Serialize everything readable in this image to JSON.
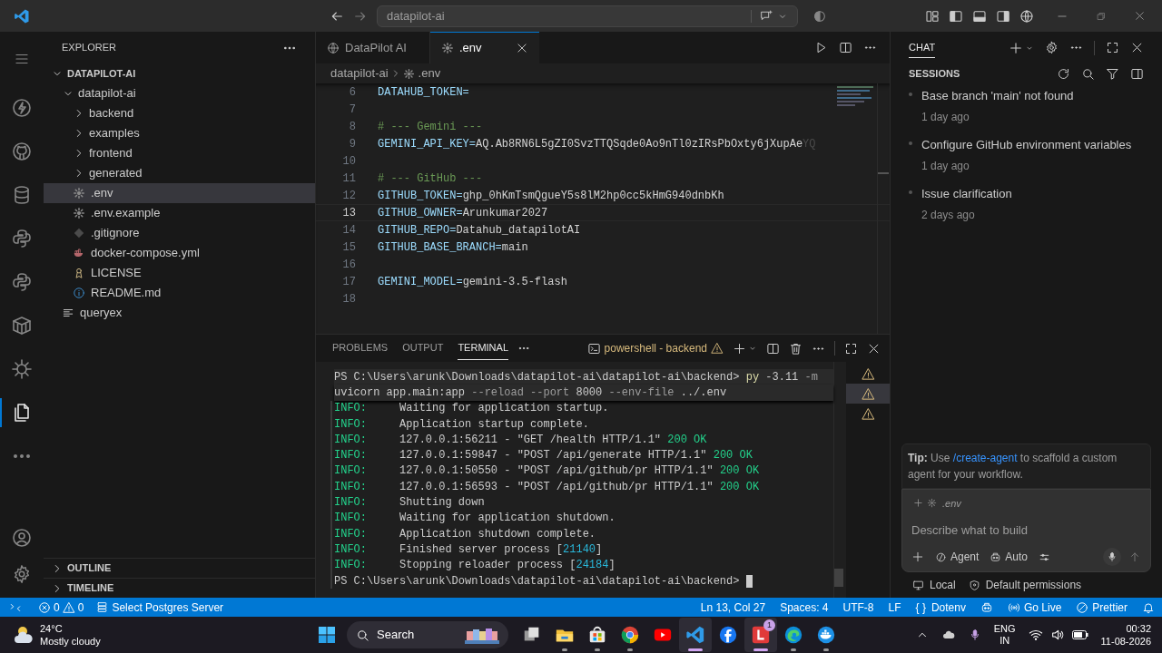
{
  "title_bar": {
    "search": "datapilot-ai"
  },
  "activity_bar": {
    "items": [
      {
        "kind": "menu",
        "selected": false
      },
      {
        "kind": "lightning",
        "selected": false
      },
      {
        "kind": "github",
        "selected": false
      },
      {
        "kind": "database",
        "selected": false
      },
      {
        "kind": "python",
        "selected": false
      },
      {
        "kind": "python",
        "selected": false
      },
      {
        "kind": "cube",
        "selected": false
      },
      {
        "kind": "helm",
        "selected": false
      },
      {
        "kind": "files",
        "selected": true
      },
      {
        "kind": "more",
        "selected": false
      }
    ],
    "bottom": [
      {
        "kind": "account"
      },
      {
        "kind": "settings"
      }
    ]
  },
  "explorer": {
    "title": "EXPLORER",
    "tree": [
      {
        "label": "DATAPILOT-AI",
        "kind": "root",
        "expanded": true,
        "selected": false,
        "children": [
          {
            "label": "datapilot-ai",
            "kind": "folder",
            "expanded": true,
            "selected": false,
            "children": [
              {
                "label": "backend",
                "kind": "folder",
                "expanded": false,
                "selected": false
              },
              {
                "label": "examples",
                "kind": "folder",
                "expanded": false,
                "selected": false
              },
              {
                "label": "frontend",
                "kind": "folder",
                "expanded": false,
                "selected": false
              },
              {
                "label": "generated",
                "kind": "folder",
                "expanded": false,
                "selected": false
              },
              {
                "label": ".env",
                "kind": "settings-file",
                "selected": true
              },
              {
                "label": ".env.example",
                "kind": "settings-file",
                "selected": false
              },
              {
                "label": ".gitignore",
                "kind": "ignore-file",
                "selected": false
              },
              {
                "label": "docker-compose.yml",
                "kind": "docker-file",
                "selected": false
              },
              {
                "label": "LICENSE",
                "kind": "license-file",
                "selected": false
              },
              {
                "label": "README.md",
                "kind": "info-file",
                "selected": false
              }
            ]
          },
          {
            "label": "queryex",
            "kind": "text-file",
            "selected": false
          }
        ]
      }
    ],
    "sections": [
      {
        "label": "OUTLINE",
        "expanded": false
      },
      {
        "label": "TIMELINE",
        "expanded": false
      }
    ]
  },
  "editor": {
    "tabs": [
      {
        "label": "DataPilot AI",
        "kind": "web",
        "selected": false
      },
      {
        "label": ".env",
        "kind": "settings-file",
        "selected": true
      }
    ],
    "breadcrumb": [
      "datapilot-ai",
      ".env"
    ],
    "lines": [
      {
        "number": "6",
        "kind": "pair",
        "key": "DATAHUB_TOKEN=",
        "current": false
      },
      {
        "number": "7",
        "kind": "blank",
        "current": false
      },
      {
        "number": "8",
        "kind": "comment",
        "text": "# --- Gemini ---",
        "current": false
      },
      {
        "number": "9",
        "kind": "pair",
        "key": "GEMINI_API_KEY=",
        "value": "AQ.Ab8RN6L5gZI0SvzTTQSqde0Ao9nTl0zIRsPbOxty6jXupAe",
        "ghost": "YQ",
        "current": false
      },
      {
        "number": "10",
        "kind": "blank",
        "current": false
      },
      {
        "number": "11",
        "kind": "comment",
        "text": "# --- GitHub ---",
        "current": false
      },
      {
        "number": "12",
        "kind": "pair",
        "key": "GITHUB_TOKEN=",
        "value": "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",
        "current": false
      },
      {
        "number": "13",
        "kind": "pair",
        "key": "GITHUB_OWNER=",
        "value": "Arunkumar2027",
        "current": true
      },
      {
        "number": "14",
        "kind": "pair",
        "key": "GITHUB_REPO=",
        "value": "Datahub_datapilotAI",
        "current": false
      },
      {
        "number": "15",
        "kind": "pair",
        "key": "GITHUB_BASE_BRANCH=",
        "value": "main",
        "current": false
      },
      {
        "number": "16",
        "kind": "blank",
        "current": false
      },
      {
        "number": "17",
        "kind": "pair",
        "key": "GEMINI_MODEL=",
        "value": "gemini-3.5-flash",
        "current": false
      },
      {
        "number": "18",
        "kind": "blank",
        "current": false
      }
    ]
  },
  "panel": {
    "tabs": [
      {
        "label": "PROBLEMS",
        "selected": false
      },
      {
        "label": "OUTPUT",
        "selected": false
      },
      {
        "label": "TERMINAL",
        "selected": true
      }
    ],
    "terminal_name": "powershell - backend",
    "terminal_instances": [
      {
        "selected": false
      },
      {
        "selected": true
      },
      {
        "selected": false
      }
    ],
    "lines": [
      {
        "sticky": true,
        "segments": [
          {
            "text": "PS C:\\Users\\arunk\\Downloads\\datapilot-ai\\datapilot-ai\\backend> ",
            "kind": "plain"
          },
          {
            "text": "py",
            "kind": "command"
          },
          {
            "text": " -3.11 ",
            "kind": "plain"
          },
          {
            "text": "-m",
            "kind": "flag"
          }
        ]
      },
      {
        "sticky": true,
        "segments": [
          {
            "text": "uvicorn app.main:app ",
            "kind": "plain"
          },
          {
            "text": "--reload --port ",
            "kind": "flag"
          },
          {
            "text": "8000 ",
            "kind": "plain"
          },
          {
            "text": "--env-file ",
            "kind": "flag"
          },
          {
            "text": "../.env",
            "kind": "plain"
          }
        ]
      },
      {
        "sticky": false,
        "segments": [
          {
            "text": "INFO:",
            "kind": "level"
          },
          {
            "text": "     Waiting for application startup.",
            "kind": "plain"
          }
        ]
      },
      {
        "sticky": false,
        "segments": [
          {
            "text": "INFO:",
            "kind": "level"
          },
          {
            "text": "     Application startup complete.",
            "kind": "plain"
          }
        ]
      },
      {
        "sticky": false,
        "segments": [
          {
            "text": "INFO:",
            "kind": "level"
          },
          {
            "text": "     127.0.0.1:56211 - \"GET /health HTTP/1.1\" ",
            "kind": "plain"
          },
          {
            "text": "200 OK",
            "kind": "status"
          }
        ]
      },
      {
        "sticky": false,
        "segments": [
          {
            "text": "INFO:",
            "kind": "level"
          },
          {
            "text": "     127.0.0.1:59847 - \"POST /api/generate HTTP/1.1\" ",
            "kind": "plain"
          },
          {
            "text": "200 OK",
            "kind": "status"
          }
        ]
      },
      {
        "sticky": false,
        "segments": [
          {
            "text": "INFO:",
            "kind": "level"
          },
          {
            "text": "     127.0.0.1:50550 - \"POST /api/github/pr HTTP/1.1\" ",
            "kind": "plain"
          },
          {
            "text": "200 OK",
            "kind": "status"
          }
        ]
      },
      {
        "sticky": false,
        "segments": [
          {
            "text": "INFO:",
            "kind": "level"
          },
          {
            "text": "     127.0.0.1:56593 - \"POST /api/github/pr HTTP/1.1\" ",
            "kind": "plain"
          },
          {
            "text": "200 OK",
            "kind": "status"
          }
        ]
      },
      {
        "sticky": false,
        "segments": [
          {
            "text": "INFO:",
            "kind": "level"
          },
          {
            "text": "     Shutting down",
            "kind": "plain"
          }
        ]
      },
      {
        "sticky": false,
        "segments": [
          {
            "text": "INFO:",
            "kind": "level"
          },
          {
            "text": "     Waiting for application shutdown.",
            "kind": "plain"
          }
        ]
      },
      {
        "sticky": false,
        "segments": [
          {
            "text": "INFO:",
            "kind": "level"
          },
          {
            "text": "     Application shutdown complete.",
            "kind": "plain"
          }
        ]
      },
      {
        "sticky": false,
        "segments": [
          {
            "text": "INFO:",
            "kind": "level"
          },
          {
            "text": "     Finished server process [",
            "kind": "plain"
          },
          {
            "text": "21140",
            "kind": "number"
          },
          {
            "text": "]",
            "kind": "plain"
          }
        ]
      },
      {
        "sticky": false,
        "segments": [
          {
            "text": "INFO:",
            "kind": "level"
          },
          {
            "text": "     Stopping reloader process [",
            "kind": "plain"
          },
          {
            "text": "24184",
            "kind": "number"
          },
          {
            "text": "]",
            "kind": "plain"
          }
        ]
      },
      {
        "sticky": false,
        "cursor": true,
        "segments": [
          {
            "text": "PS C:\\Users\\arunk\\Downloads\\datapilot-ai\\datapilot-ai\\backend> ",
            "kind": "plain"
          }
        ]
      }
    ]
  },
  "chat": {
    "title": "CHAT",
    "sessions_title": "SESSIONS",
    "sessions": [
      {
        "title": "Base branch 'main' not found",
        "time": "1 day ago"
      },
      {
        "title": "Configure GitHub environment variables",
        "time": "1 day ago"
      },
      {
        "title": "Issue clarification",
        "time": "2 days ago"
      }
    ],
    "tip": {
      "label": "Tip:",
      "before": " Use ",
      "link": "/create-agent",
      "after": " to scaffold a custom agent for your workflow."
    },
    "input": {
      "context": ".env",
      "placeholder": "Describe what to build",
      "mode": "Agent",
      "model": "Auto"
    },
    "footer": [
      {
        "kind": "local",
        "label": "Local"
      },
      {
        "kind": "permissions",
        "label": "Default permissions"
      }
    ]
  },
  "status_bar": {
    "left": [
      {
        "kind": "remote"
      },
      {
        "kind": "problems",
        "errors": "0",
        "warnings": "0"
      },
      {
        "kind": "postgres",
        "label": "Select Postgres Server"
      }
    ],
    "right": [
      {
        "kind": "text",
        "label": "Ln 13, Col 27"
      },
      {
        "kind": "text",
        "label": "Spaces: 4"
      },
      {
        "kind": "text",
        "label": "UTF-8"
      },
      {
        "kind": "text",
        "label": "LF"
      },
      {
        "kind": "language",
        "glyph": "{ }",
        "label": "Dotenv"
      },
      {
        "kind": "copilot"
      },
      {
        "kind": "live",
        "label": "Go Live"
      },
      {
        "kind": "prettier",
        "label": "Prettier"
      },
      {
        "kind": "bell"
      }
    ]
  },
  "taskbar": {
    "weather": {
      "temp": "24°C",
      "desc": "Mostly cloudy"
    },
    "search": "Search",
    "apps": [
      {
        "kind": "task-view",
        "running": false,
        "selected": false
      },
      {
        "kind": "folder",
        "running": true,
        "selected": false
      },
      {
        "kind": "store",
        "running": true,
        "selected": false
      },
      {
        "kind": "chrome",
        "running": true,
        "selected": false
      },
      {
        "kind": "youtube",
        "running": false,
        "selected": false
      },
      {
        "kind": "vscode",
        "running": true,
        "selected": true
      },
      {
        "kind": "facebook",
        "running": false,
        "selected": false
      },
      {
        "kind": "l-app",
        "running": true,
        "selected": true,
        "badge": "1"
      },
      {
        "kind": "edge",
        "running": true,
        "selected": false
      },
      {
        "kind": "docker",
        "running": true,
        "selected": false
      }
    ],
    "tray": {
      "lang": "ENG",
      "region": "IN",
      "time": "00:32",
      "date": "11-08-2026"
    }
  }
}
